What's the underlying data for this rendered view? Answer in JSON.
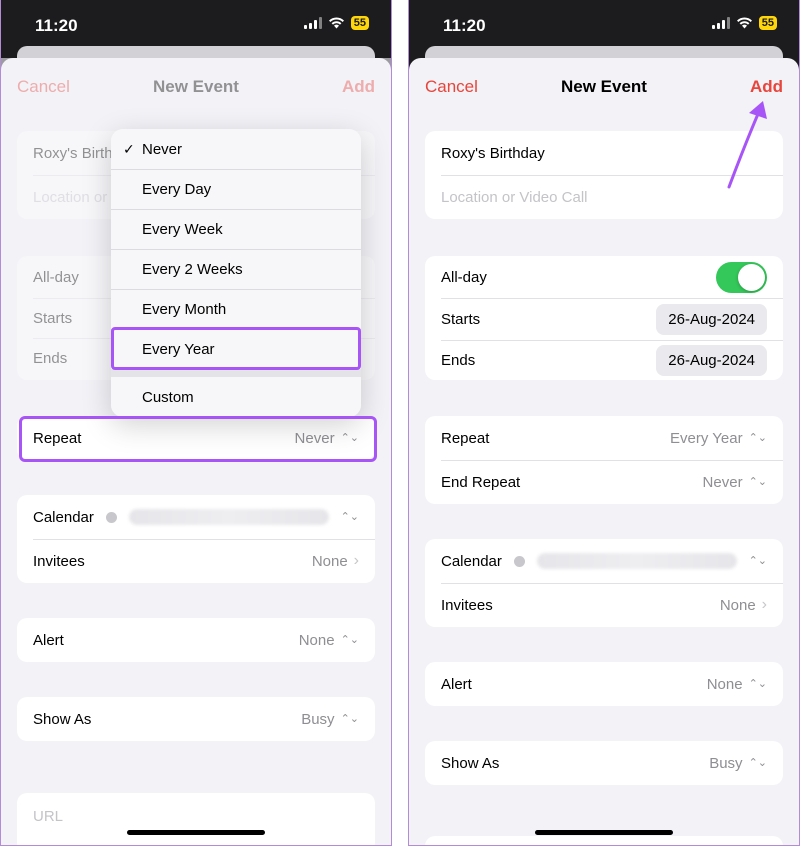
{
  "status": {
    "time": "11:20",
    "battery": "55"
  },
  "left": {
    "nav": {
      "cancel": "Cancel",
      "title": "New Event",
      "add": "Add"
    },
    "title_value": "Roxy's Birth",
    "location_placeholder": "Location or",
    "allday_label": "All-day",
    "starts_label": "Starts",
    "ends_label": "Ends",
    "repeat": {
      "label": "Repeat",
      "value": "Never"
    },
    "calendar_label": "Calendar",
    "invitees": {
      "label": "Invitees",
      "value": "None"
    },
    "alert": {
      "label": "Alert",
      "value": "None"
    },
    "show_as": {
      "label": "Show As",
      "value": "Busy"
    },
    "url_placeholder": "URL",
    "menu": {
      "items": [
        "Never",
        "Every Day",
        "Every Week",
        "Every 2 Weeks",
        "Every Month",
        "Every Year"
      ],
      "custom": "Custom",
      "checkmark": "✓",
      "selected": "Never"
    }
  },
  "right": {
    "nav": {
      "cancel": "Cancel",
      "title": "New Event",
      "add": "Add"
    },
    "title_value": "Roxy's Birthday",
    "location_placeholder": "Location or Video Call",
    "allday": {
      "label": "All-day",
      "on": true
    },
    "starts": {
      "label": "Starts",
      "value": "26-Aug-2024"
    },
    "ends": {
      "label": "Ends",
      "value": "26-Aug-2024"
    },
    "repeat": {
      "label": "Repeat",
      "value": "Every Year"
    },
    "end_repeat": {
      "label": "End Repeat",
      "value": "Never"
    },
    "calendar_label": "Calendar",
    "invitees": {
      "label": "Invitees",
      "value": "None"
    },
    "alert": {
      "label": "Alert",
      "value": "None"
    },
    "show_as": {
      "label": "Show As",
      "value": "Busy"
    }
  },
  "icons": {
    "chevron_updown": "⌃⌄",
    "chevron_right": "›"
  },
  "colors": {
    "accent": "#e8453c",
    "highlight": "#a855f7",
    "toggle_on": "#34c759"
  }
}
